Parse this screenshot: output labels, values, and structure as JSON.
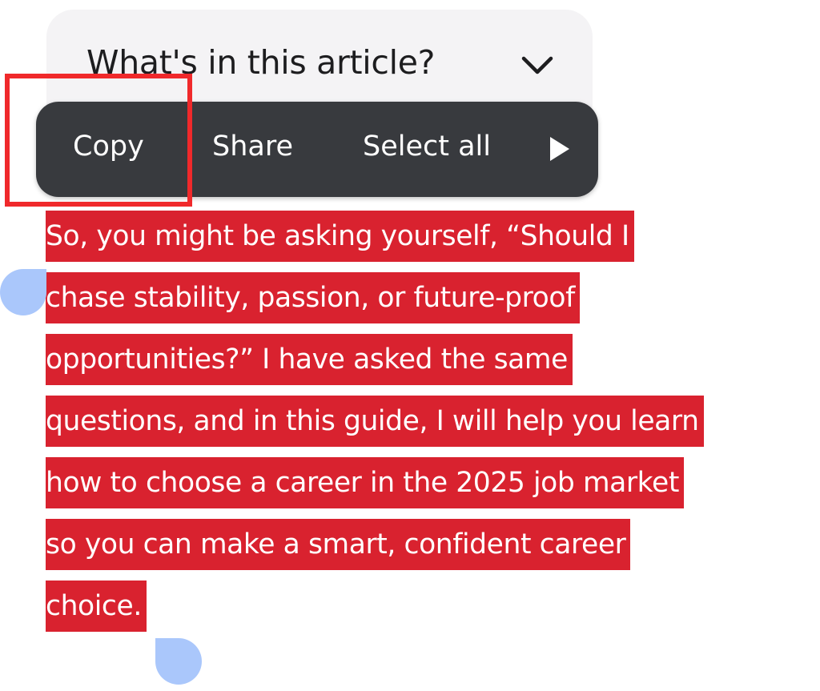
{
  "toc": {
    "title": "What's in this article?",
    "chevron_icon": "chevron-down-icon"
  },
  "toolbar": {
    "copy_label": "Copy",
    "share_label": "Share",
    "select_all_label": "Select all",
    "more_icon": "play-triangle-icon"
  },
  "article": {
    "lines": [
      "So, you might be asking yourself, “Should I",
      "chase stability, passion, or future-proof",
      "opportunities?” I have asked the same",
      "questions, and in this guide, I will help you learn",
      "how to choose a career in the 2025 job market",
      "so you can make a smart, confident career",
      "choice."
    ]
  },
  "colors": {
    "selection": "#d9222f",
    "toolbar_bg": "#383a3e",
    "annotation": "#f0292b",
    "handle": "#aac7fb",
    "card_bg": "#f4f3f5"
  }
}
